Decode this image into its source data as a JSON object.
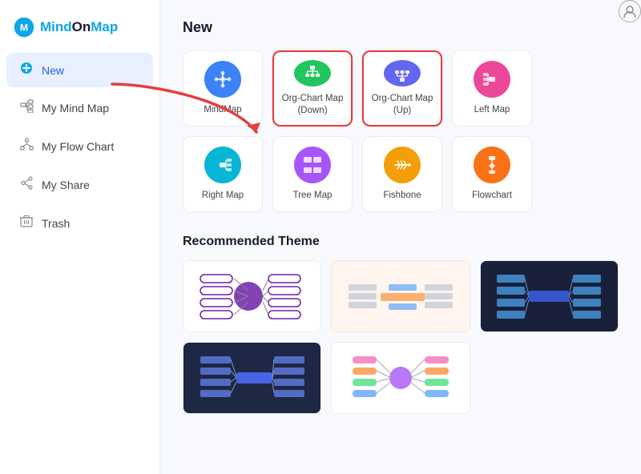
{
  "logo": {
    "text_mind": "Mind",
    "text_on": "On",
    "text_map": "Map"
  },
  "sidebar": {
    "items": [
      {
        "id": "new",
        "label": "New",
        "icon": "➕",
        "active": true
      },
      {
        "id": "my-mind-map",
        "label": "My Mind Map",
        "icon": "🗺"
      },
      {
        "id": "my-flow-chart",
        "label": "My Flow Chart",
        "icon": "🔀"
      },
      {
        "id": "my-share",
        "label": "My Share",
        "icon": "🔗"
      },
      {
        "id": "trash",
        "label": "Trash",
        "icon": "🗑"
      }
    ]
  },
  "main": {
    "new_section_title": "New",
    "map_types": [
      {
        "id": "mindmap",
        "label": "MindMap",
        "color": "#3b82f6",
        "icon": "❄",
        "highlighted": false
      },
      {
        "id": "org-chart-down",
        "label": "Org-Chart Map\n(Down)",
        "color": "#22c55e",
        "icon": "⊞",
        "highlighted": true
      },
      {
        "id": "org-chart-up",
        "label": "Org-Chart Map (Up)",
        "color": "#6366f1",
        "icon": "⚓",
        "highlighted": true
      },
      {
        "id": "left-map",
        "label": "Left Map",
        "color": "#ec4899",
        "icon": "⊣",
        "highlighted": false
      },
      {
        "id": "right-map",
        "label": "Right Map",
        "color": "#06b6d4",
        "icon": "⊢",
        "highlighted": false
      },
      {
        "id": "tree-map",
        "label": "Tree Map",
        "color": "#a855f7",
        "icon": "⊟",
        "highlighted": false
      },
      {
        "id": "fishbone",
        "label": "Fishbone",
        "color": "#f59e0b",
        "icon": "✦",
        "highlighted": false
      },
      {
        "id": "flowchart",
        "label": "Flowchart",
        "color": "#f97316",
        "icon": "⊛",
        "highlighted": false
      }
    ],
    "recommended_title": "Recommended Theme",
    "themes": [
      {
        "id": "theme-1",
        "bg": "#fff",
        "type": "light-purple"
      },
      {
        "id": "theme-2",
        "bg": "#fff",
        "type": "light-orange"
      },
      {
        "id": "theme-3",
        "bg": "#1a1f3a",
        "type": "dark-blue"
      },
      {
        "id": "theme-4",
        "bg": "#1e2744",
        "type": "dark-navy"
      },
      {
        "id": "theme-5",
        "bg": "#fff",
        "type": "light-colorful"
      }
    ]
  }
}
